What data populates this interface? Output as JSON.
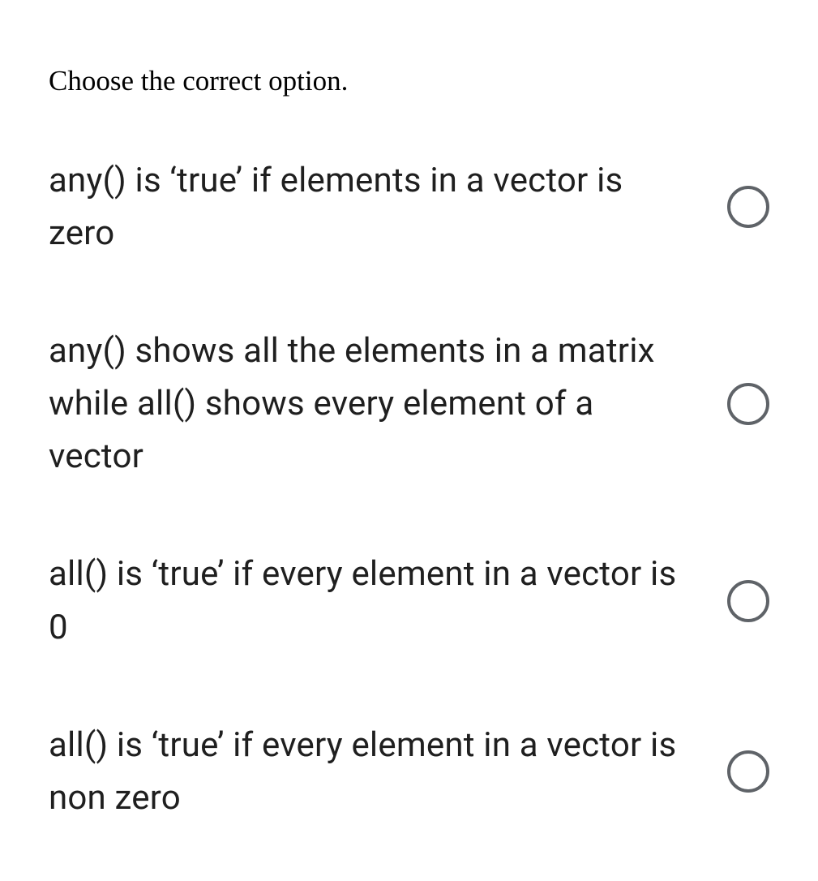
{
  "question": {
    "prompt": "Choose the correct option.",
    "options": [
      {
        "text": "any() is ‘true’ if elements in a vector is zero"
      },
      {
        "text": "any() shows all the elements in a matrix while all() shows every element of a vector"
      },
      {
        "text": "all() is ‘true’ if every element in a vector is 0"
      },
      {
        "text": "all() is ‘true’ if every element in a vector is non zero"
      }
    ]
  }
}
